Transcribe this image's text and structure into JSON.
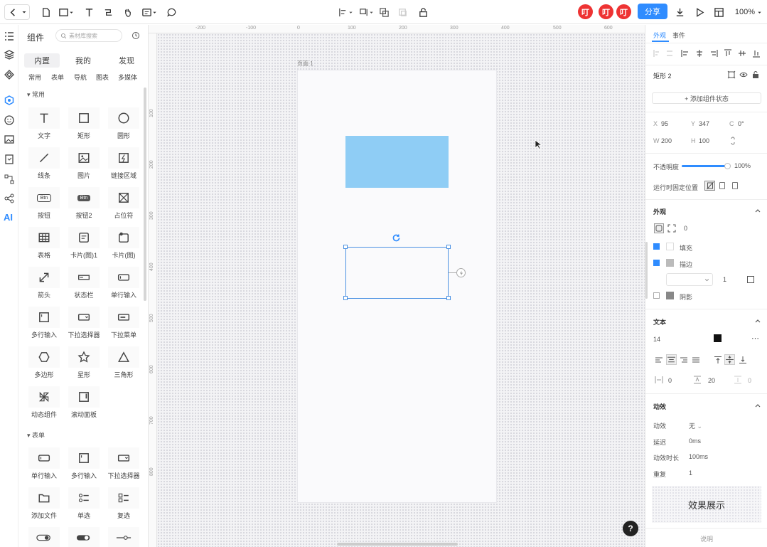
{
  "toolbar": {
    "share_label": "分享",
    "zoom": "100%",
    "avatars": [
      "叮",
      "叮",
      "叮"
    ],
    "icons": [
      "back-icon",
      "new-page-icon",
      "rectangle-tool-icon",
      "text-tool-icon",
      "connector-tool-icon",
      "hand-tool-icon",
      "comment-tool-icon",
      "chat-icon",
      "align-icon",
      "group-icon",
      "duplicate-icon",
      "lock-icon",
      "download-icon",
      "play-icon",
      "layout-icon"
    ]
  },
  "panel": {
    "title": "组件",
    "search_placeholder": "素材库搜索",
    "tabs": [
      "内置",
      "我的",
      "发现"
    ],
    "subtabs": [
      "常用",
      "表单",
      "导航",
      "图表",
      "多媒体"
    ],
    "section_common": "常用",
    "section_form": "表单",
    "common_items": [
      "文字",
      "矩形",
      "圆形",
      "线条",
      "图片",
      "链接区域",
      "按钮",
      "按钮2",
      "占位符",
      "表格",
      "卡片(图)1",
      "卡片(图)",
      "箭头",
      "状态栏",
      "单行输入",
      "多行输入",
      "下拉选择器",
      "下拉菜单",
      "多边形",
      "星形",
      "三角形",
      "动态组件",
      "滚动面板"
    ],
    "form_items": [
      "单行输入",
      "多行输入",
      "下拉选择器",
      "添加文件",
      "单选",
      "复选"
    ],
    "button_icon_text": "Btn"
  },
  "canvas": {
    "ruler_top": [
      "-200",
      "-100",
      "0",
      "100",
      "200",
      "300",
      "400",
      "500",
      "600"
    ],
    "ruler_left": [
      "100",
      "200",
      "300",
      "400",
      "500",
      "600",
      "700",
      "800"
    ],
    "artboard_label": "页面 1",
    "fill_color": "#8fcdf5",
    "selection_color": "#4a90e2"
  },
  "props": {
    "tabs": [
      "外观",
      "事件"
    ],
    "element_name": "矩形 2",
    "add_state": "+ 添加组件状态",
    "x_label": "X",
    "x_value": "95",
    "y_label": "Y",
    "y_value": "347",
    "rot_label": "C",
    "rot_value": "0°",
    "w_label": "W",
    "w_value": "200",
    "h_label": "H",
    "h_value": "100",
    "opacity_label": "不透明度",
    "opacity_value": "100%",
    "opacity_level": 1.0,
    "fixed_label": "运行时固定位置",
    "appearance_title": "外观",
    "radius_value": "0",
    "fill_label": "填充",
    "stroke_label": "描边",
    "stroke_width": "1",
    "shadow_label": "阴影",
    "text_title": "文本",
    "font_size": "14",
    "letter_spacing": "0",
    "line_height": "20",
    "para_spacing": "0",
    "anim_title": "动效",
    "anim_rows": [
      {
        "label": "动效",
        "value": "无"
      },
      {
        "label": "延迟",
        "value": "0ms"
      },
      {
        "label": "动效时长",
        "value": "100ms"
      },
      {
        "label": "重复",
        "value": "1"
      }
    ],
    "preview_label": "效果展示",
    "footer": "说明"
  },
  "help_label": "?"
}
